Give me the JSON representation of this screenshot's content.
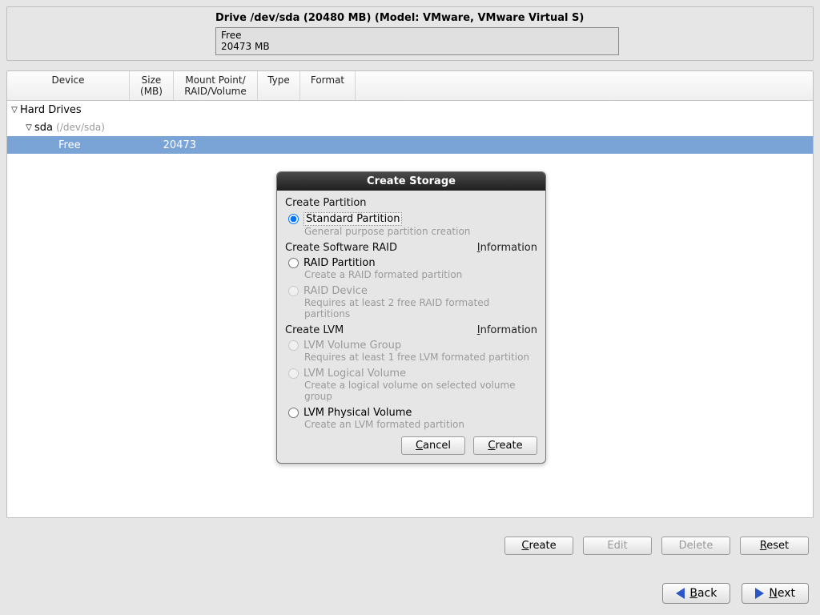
{
  "drive": {
    "title": "Drive /dev/sda (20480 MB) (Model: VMware, VMware Virtual S)",
    "free_label": "Free",
    "free_size": "20473 MB"
  },
  "columns": {
    "device": "Device",
    "size": "Size\n(MB)",
    "mount": "Mount Point/\nRAID/Volume",
    "type": "Type",
    "format": "Format"
  },
  "tree": {
    "root": "Hard Drives",
    "disk_name": "sda",
    "disk_path": "(/dev/sda)",
    "free_row_label": "Free",
    "free_row_size": "20473"
  },
  "buttons": {
    "create": "Create",
    "edit": "Edit",
    "delete": "Delete",
    "reset": "Reset",
    "back": "Back",
    "next": "Next"
  },
  "dialog": {
    "title": "Create Storage",
    "section_partition": "Create Partition",
    "opt_std": "Standard Partition",
    "opt_std_desc": "General purpose partition creation",
    "section_raid": "Create Software RAID",
    "info": "Information",
    "opt_raid_part": "RAID Partition",
    "opt_raid_part_desc": "Create a RAID formated partition",
    "opt_raid_dev": "RAID Device",
    "opt_raid_dev_desc": "Requires at least 2 free RAID formated partitions",
    "section_lvm": "Create LVM",
    "opt_lvm_vg": "LVM Volume Group",
    "opt_lvm_vg_desc": "Requires at least 1 free LVM formated partition",
    "opt_lvm_lv": "LVM Logical Volume",
    "opt_lvm_lv_desc": "Create a logical volume on selected volume group",
    "opt_lvm_pv": "LVM Physical Volume",
    "opt_lvm_pv_desc": "Create an LVM formated partition",
    "cancel": "Cancel",
    "create": "Create"
  }
}
